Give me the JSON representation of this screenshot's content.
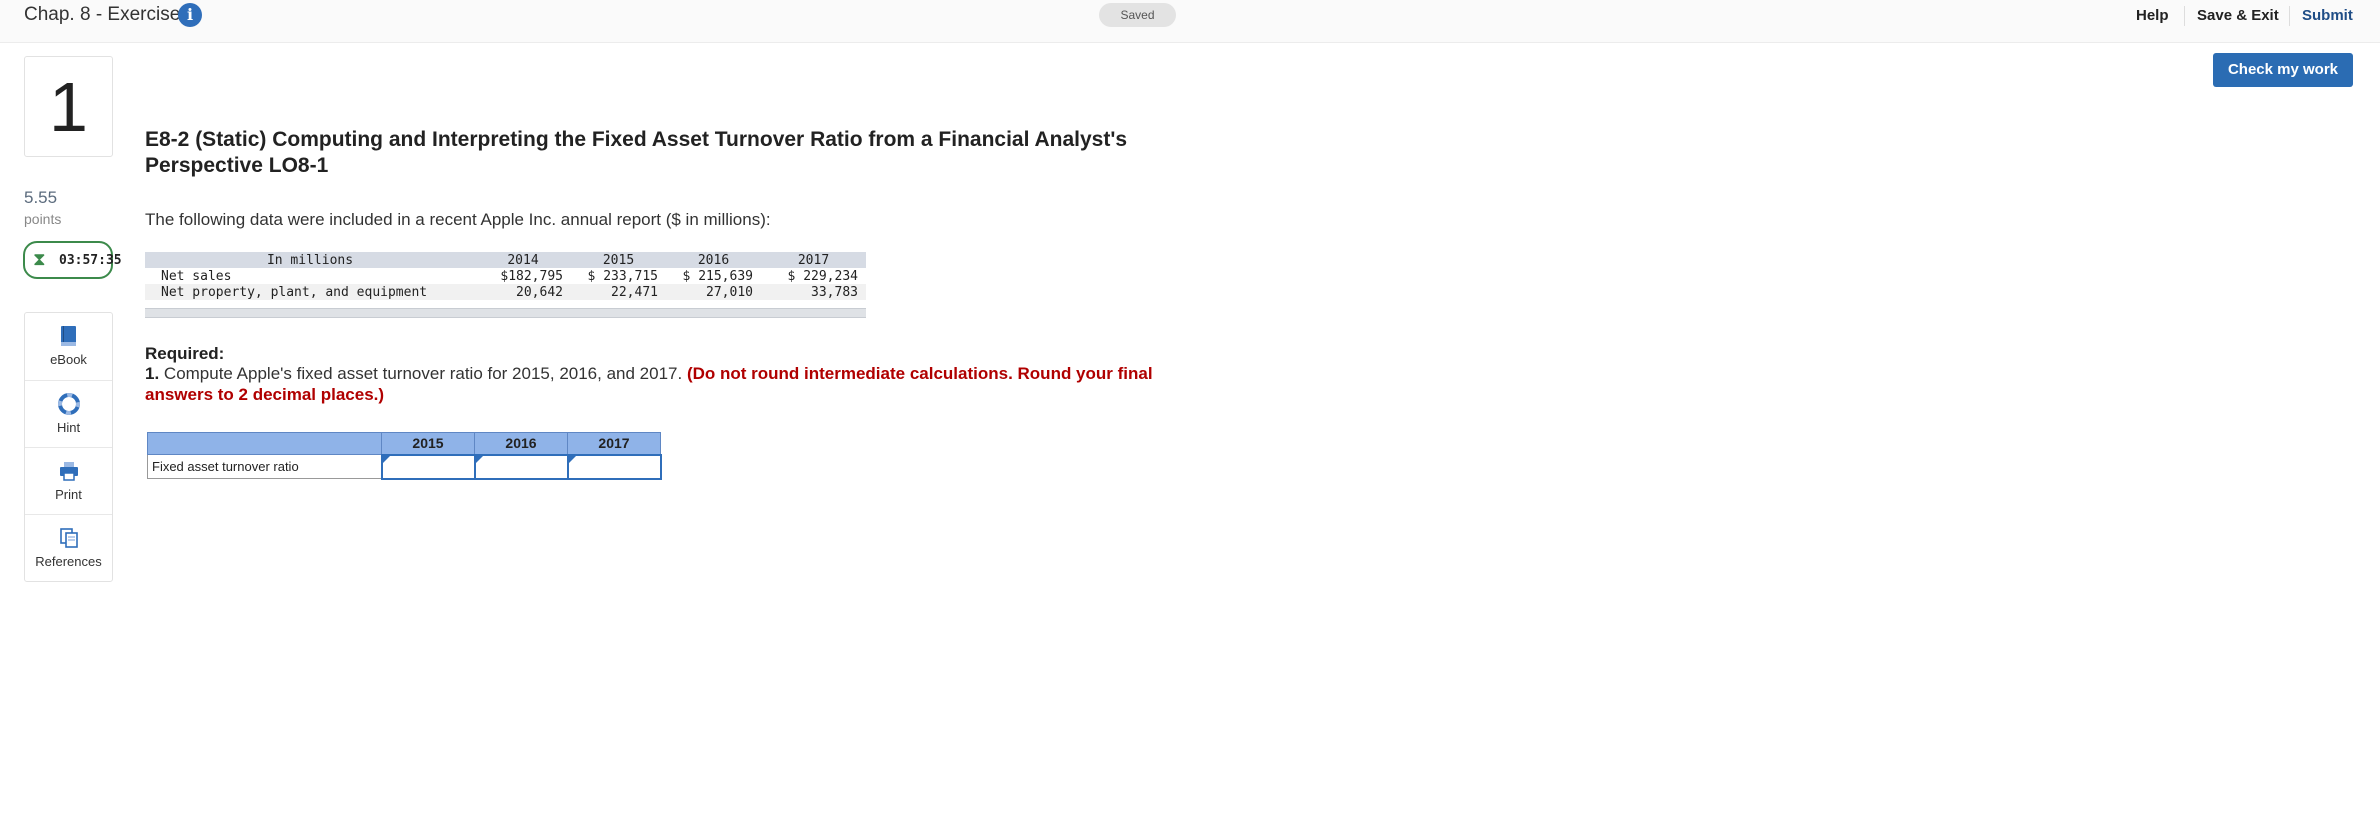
{
  "header": {
    "chapter_title": "Chap. 8 - Exercises",
    "saved_label": "Saved",
    "help_label": "Help",
    "save_exit_label": "Save & Exit",
    "submit_label": "Submit"
  },
  "sidebar": {
    "question_number": "1",
    "points_value": "5.55",
    "points_label": "points",
    "timer": "03:57:35",
    "tools": [
      {
        "label": "eBook",
        "icon": "book-icon"
      },
      {
        "label": "Hint",
        "icon": "lifebuoy-icon"
      },
      {
        "label": "Print",
        "icon": "printer-icon"
      },
      {
        "label": "References",
        "icon": "documents-icon"
      }
    ]
  },
  "check_my_work_label": "Check my work",
  "question": {
    "title": "E8-2 (Static) Computing and Interpreting the Fixed Asset Turnover Ratio from a Financial Analyst's Perspective LO8-1",
    "intro": "The following data were included in a recent Apple Inc. annual report ($ in millions):",
    "data_table": {
      "header": [
        "In millions",
        "2014",
        "2015",
        "2016",
        "2017"
      ],
      "rows": [
        [
          "Net sales",
          "$182,795",
          "$ 233,715",
          "$ 215,639",
          "$ 229,234"
        ],
        [
          "Net property, plant, and equipment",
          "20,642",
          "22,471",
          "27,010",
          "33,783"
        ]
      ]
    },
    "required_label": "Required:",
    "required_number": "1.",
    "required_text": " Compute Apple's fixed asset turnover ratio for 2015, 2016, and 2017. ",
    "required_note": "(Do not round intermediate calculations. Round your final answers to 2 decimal places.)"
  },
  "answer_table": {
    "columns": [
      "2015",
      "2016",
      "2017"
    ],
    "row_label": "Fixed asset turnover ratio",
    "values": [
      "",
      "",
      ""
    ]
  },
  "colors": {
    "accent": "#2b6cb3",
    "timer_border": "#3c8a4b",
    "note_red": "#b00000",
    "answer_header": "#8fb3e8"
  }
}
